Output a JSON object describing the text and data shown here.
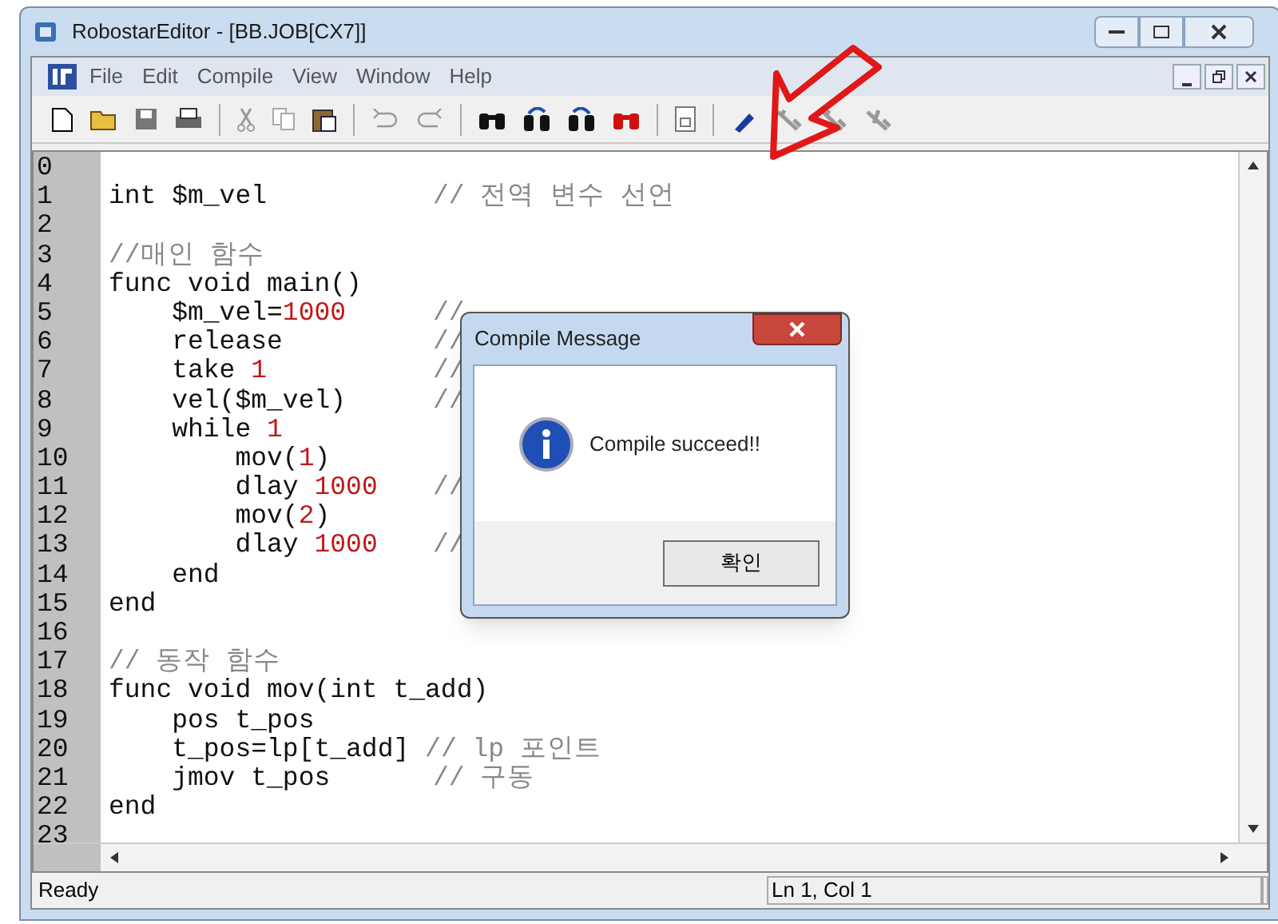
{
  "window": {
    "title": "RobostarEditor - [BB.JOB[CX7]]"
  },
  "menu": [
    "File",
    "Edit",
    "Compile",
    "View",
    "Window",
    "Help"
  ],
  "editor": {
    "lines": [
      {
        "number": "0"
      },
      {
        "number": "1",
        "segments": [
          {
            "kind": "code",
            "text": "int $m_vel"
          },
          {
            "kind": "aligned_comment",
            "text": "// 전역 변수 선언"
          }
        ]
      },
      {
        "number": "2"
      },
      {
        "number": "3",
        "segments": [
          {
            "kind": "comment",
            "text": "//매인 함수"
          }
        ]
      },
      {
        "number": "4",
        "segments": [
          {
            "kind": "code",
            "text": "func void main()"
          }
        ]
      },
      {
        "number": "5",
        "segments": [
          {
            "kind": "code",
            "text": "    $m_vel="
          },
          {
            "kind": "number",
            "text": "1000"
          },
          {
            "kind": "aligned_comment",
            "text": "//"
          }
        ]
      },
      {
        "number": "6",
        "segments": [
          {
            "kind": "code",
            "text": "    release"
          },
          {
            "kind": "aligned_comment",
            "text": "//"
          }
        ]
      },
      {
        "number": "7",
        "segments": [
          {
            "kind": "code",
            "text": "    take "
          },
          {
            "kind": "number",
            "text": "1"
          },
          {
            "kind": "aligned_comment",
            "text": "//"
          }
        ]
      },
      {
        "number": "8",
        "segments": [
          {
            "kind": "code",
            "text": "    vel($m_vel)"
          },
          {
            "kind": "aligned_comment",
            "text": "//"
          }
        ]
      },
      {
        "number": "9",
        "segments": [
          {
            "kind": "code",
            "text": "    while "
          },
          {
            "kind": "number",
            "text": "1"
          }
        ]
      },
      {
        "number": "10",
        "segments": [
          {
            "kind": "code",
            "text": "        mov("
          },
          {
            "kind": "number",
            "text": "1"
          },
          {
            "kind": "code",
            "text": ")"
          }
        ]
      },
      {
        "number": "11",
        "segments": [
          {
            "kind": "code",
            "text": "        dlay "
          },
          {
            "kind": "number",
            "text": "1000"
          },
          {
            "kind": "aligned_comment",
            "text": "//"
          }
        ]
      },
      {
        "number": "12",
        "segments": [
          {
            "kind": "code",
            "text": "        mov("
          },
          {
            "kind": "number",
            "text": "2"
          },
          {
            "kind": "code",
            "text": ")"
          }
        ]
      },
      {
        "number": "13",
        "segments": [
          {
            "kind": "code",
            "text": "        dlay "
          },
          {
            "kind": "number",
            "text": "1000"
          },
          {
            "kind": "aligned_comment",
            "text": "//"
          }
        ]
      },
      {
        "number": "14",
        "segments": [
          {
            "kind": "code",
            "text": "    end"
          }
        ]
      },
      {
        "number": "15",
        "segments": [
          {
            "kind": "code",
            "text": "end"
          }
        ]
      },
      {
        "number": "16"
      },
      {
        "number": "17",
        "segments": [
          {
            "kind": "comment",
            "text": "// 동작 함수"
          }
        ]
      },
      {
        "number": "18",
        "segments": [
          {
            "kind": "code",
            "text": "func void mov(int t_add)"
          }
        ]
      },
      {
        "number": "19",
        "segments": [
          {
            "kind": "code",
            "text": "    pos t_pos"
          }
        ]
      },
      {
        "number": "20",
        "segments": [
          {
            "kind": "code",
            "text": "    t_pos=lp[t_add] "
          },
          {
            "kind": "comment",
            "text": "// lp 포인트"
          }
        ]
      },
      {
        "number": "21",
        "segments": [
          {
            "kind": "code",
            "text": "    jmov t_pos"
          },
          {
            "kind": "aligned_comment",
            "text": "// 구동"
          }
        ]
      },
      {
        "number": "22",
        "segments": [
          {
            "kind": "code",
            "text": "end"
          }
        ]
      },
      {
        "number": "23"
      }
    ]
  },
  "dialog": {
    "title": "Compile Message",
    "message": "Compile succeed!!",
    "button": "확인"
  },
  "status_bar": {
    "message": "Ready",
    "position": "Ln 1, Col 1"
  }
}
